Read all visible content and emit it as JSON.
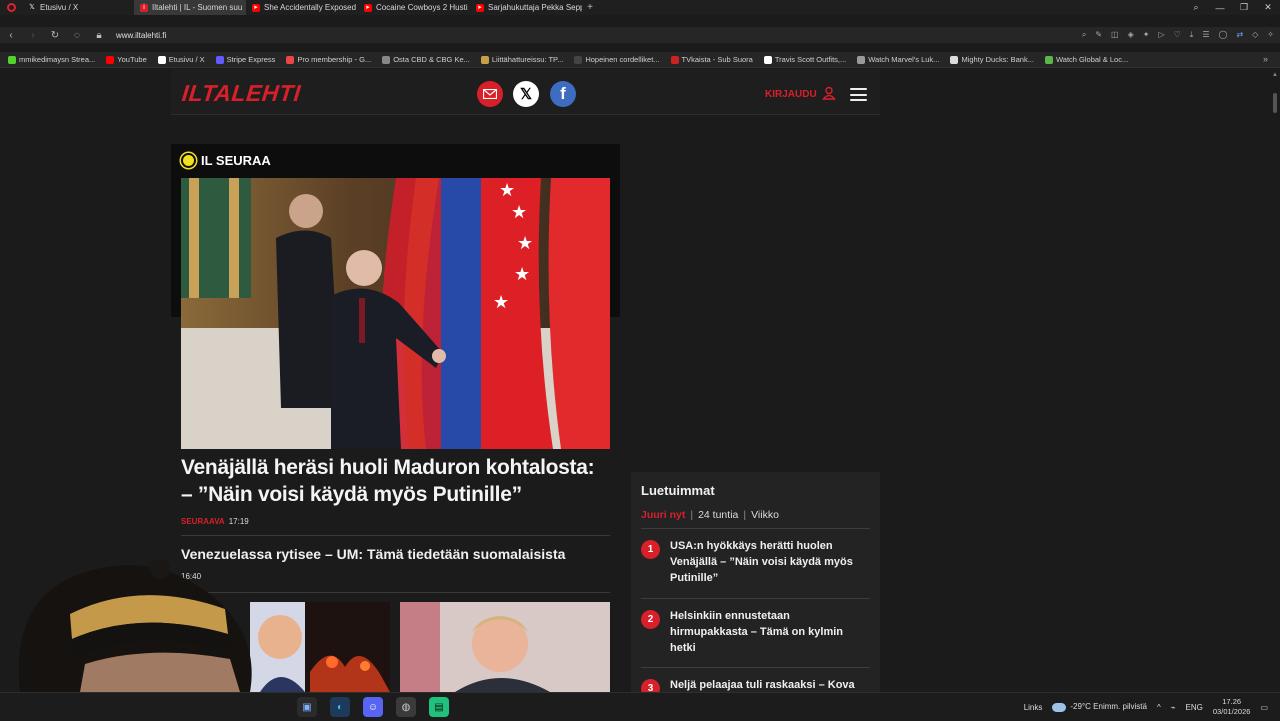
{
  "browser": {
    "tabs": [
      {
        "title": "Etusivu / X",
        "active": false,
        "favicon": "x-favicon"
      },
      {
        "title": "Iltalehti | IL - Suomen suu",
        "active": true,
        "favicon": "iltalehti-favicon"
      },
      {
        "title": "She Accidentally Exposed",
        "active": false,
        "favicon": "youtube-favicon"
      },
      {
        "title": "Cocaine Cowboys 2 Husti",
        "active": false,
        "favicon": "youtube-favicon"
      },
      {
        "title": "Sarjahukuttaja Pekka Sepp",
        "active": false,
        "favicon": "youtube-favicon"
      }
    ],
    "url": "www.iltalehti.fi",
    "bookmarks": [
      {
        "label": "mmikedimaysn Strea...",
        "color": "#53d22a"
      },
      {
        "label": "YouTube",
        "color": "#ff0000"
      },
      {
        "label": "Etusivu / X",
        "color": "#ffffff"
      },
      {
        "label": "Stripe Express",
        "color": "#635bff"
      },
      {
        "label": "Pro membership - G...",
        "color": "#e94646"
      },
      {
        "label": "Osta CBD & CBG Ke...",
        "color": "#888888"
      },
      {
        "label": "Liittähattureissu: TP...",
        "color": "#c9a04a"
      },
      {
        "label": "Hopeinen cordelliket...",
        "color": "#444444"
      },
      {
        "label": "TVkaista - Sub Suora",
        "color": "#cc2222"
      },
      {
        "label": "Travis Scott Outfits,...",
        "color": "#ffffff"
      },
      {
        "label": "Watch Marvel's Luk...",
        "color": "#999999"
      },
      {
        "label": "Mighty Ducks: Bank...",
        "color": "#dddddd"
      },
      {
        "label": "Watch Global & Loc...",
        "color": "#5ab84a"
      }
    ]
  },
  "site": {
    "logo": "ILTALEHTI",
    "login_label": "KIRJAUDU",
    "brand_color": "#d8202a",
    "section_label": "IL SEURAA",
    "hero": {
      "title": "Venäjällä heräsi huoli Maduron kohtalosta: – ”Näin voisi käydä myös Putinille”",
      "tag": "SEURAAVA",
      "time": "17:19"
    },
    "story2": {
      "title": "Venezuelassa rytisee – UM: Tämä tiedetään suomalaisista",
      "time": "16:40"
    },
    "popular": {
      "title": "Luetuimmat",
      "tabs": {
        "now": "Juuri nyt",
        "day": "24 tuntia",
        "week": "Viikko"
      },
      "items": [
        {
          "num": "1",
          "text": "USA:n hyökkäys herätti huolen Venäjällä – ”Näin voisi käydä myös Putinille”"
        },
        {
          "num": "2",
          "text": "Helsinkiin ennustetaan hirmupakkasta – Tämä on kylmin hetki"
        },
        {
          "num": "3",
          "text": "Neljä pelaajaa tuli raskaaksi – Kova"
        }
      ]
    }
  },
  "taskbar": {
    "links_label": "Links",
    "weather": "-29°C  Enimm. pilvistä",
    "language": "ENG",
    "time": "17.26",
    "date": "03/01/2026"
  }
}
